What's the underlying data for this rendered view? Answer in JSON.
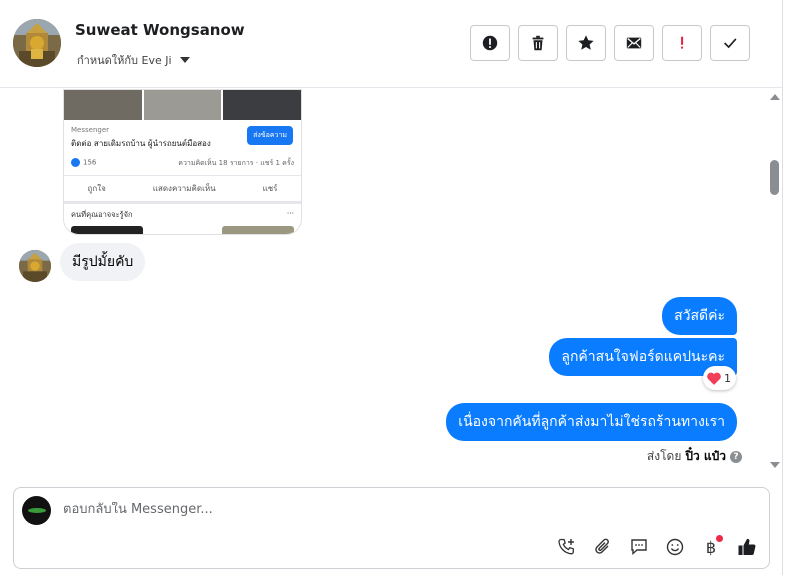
{
  "header": {
    "contact_name": "Suweat Wongsanow",
    "assign_label": "กำหนดให้กับ Eve Ji",
    "actions": [
      {
        "name": "spam-button",
        "icon": "alert-circle-icon"
      },
      {
        "name": "delete-button",
        "icon": "trash-icon"
      },
      {
        "name": "star-button",
        "icon": "star-icon"
      },
      {
        "name": "mark-unread-button",
        "icon": "envelope-icon"
      },
      {
        "name": "follow-up-button",
        "icon": "exclamation-icon"
      },
      {
        "name": "mark-done-button",
        "icon": "check-icon"
      }
    ]
  },
  "shared_post": {
    "source": "Messenger",
    "title": "ติดต่อ สายเดิมรถบ้าน ผู้นำรถยนต์มือสอง",
    "button_label": "ส่งข้อความ",
    "likes": "156",
    "stats": "ความคิดเห็น 18 รายการ · แชร์ 1 ครั้ง",
    "actions": [
      "ถูกใจ",
      "แสดงความคิดเห็น",
      "แชร์"
    ],
    "footer": "คนที่คุณอาจจะรู้จัก",
    "footer_more": "···"
  },
  "messages": {
    "incoming": [
      {
        "text": "มีรูปมั้ยคับ"
      }
    ],
    "outgoing": [
      {
        "text": "สวัสดีค่ะ"
      },
      {
        "text": "ลูกค้าสนใจฟอร์ดแคปนะคะ"
      },
      {
        "text": "เนื่องจากคันที่ลูกค้าส่งมาไม่ใช่รถร้านทางเรา"
      }
    ],
    "reaction": {
      "emoji": "❤️",
      "count": "1"
    },
    "sent_by_label": "ส่งโดย",
    "sent_by_name": "ปิ๋ว แป๋ว",
    "help_glyph": "?"
  },
  "composer": {
    "placeholder": "ตอบกลับใน Messenger...",
    "value": ""
  },
  "colors": {
    "outgoing_bubble": "#0a7cff",
    "incoming_bubble": "#f0f2f5",
    "notification_dot": "#f02849",
    "follow_up_icon": "#e41e3f"
  }
}
